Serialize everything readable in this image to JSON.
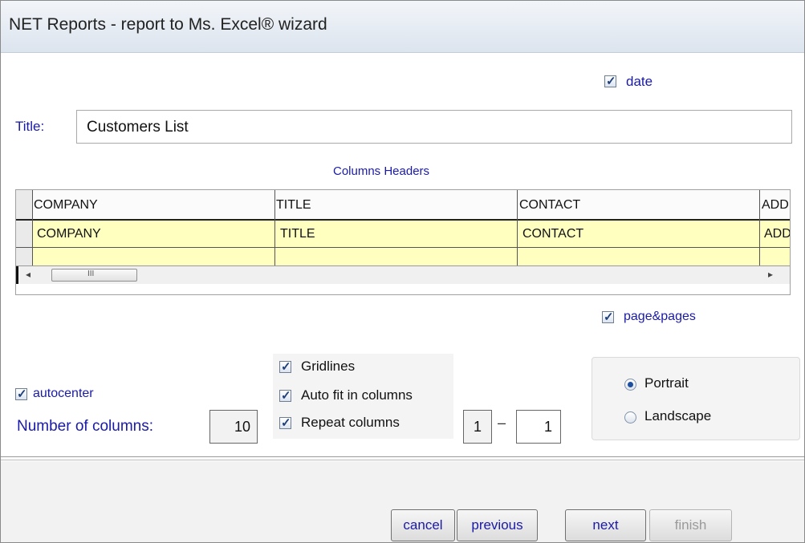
{
  "window": {
    "title": "NET Reports - report to Ms. Excel® wizard"
  },
  "options": {
    "date_label": "date",
    "date_checked": true,
    "page_pages_label": "page&pages",
    "page_pages_checked": true,
    "autocenter_label": "autocenter",
    "autocenter_checked": true,
    "gridlines_label": "Gridlines",
    "gridlines_checked": true,
    "autofit_label": "Auto fit in columns",
    "autofit_checked": true,
    "repeat_label": "Repeat columns",
    "repeat_checked": true,
    "repeat_from": "1",
    "repeat_separator": "–",
    "repeat_to": "1",
    "num_columns_label": "Number of columns:",
    "num_columns_value": "10"
  },
  "title_field": {
    "label": "Title:",
    "value": "Customers List"
  },
  "headers_grid": {
    "caption": "Columns Headers",
    "columns": [
      "COMPANY",
      "TITLE",
      "CONTACT",
      "ADD"
    ],
    "row": [
      "COMPANY",
      "TITLE",
      "CONTACT",
      "ADD"
    ],
    "scroll_left": "◂",
    "scroll_right": "▸",
    "thumb_grip": "III"
  },
  "orientation": {
    "portrait_label": "Portrait",
    "landscape_label": "Landscape",
    "selected": "Portrait"
  },
  "buttons": {
    "cancel": "cancel",
    "previous": "previous",
    "next": "next",
    "finish": "finish"
  }
}
